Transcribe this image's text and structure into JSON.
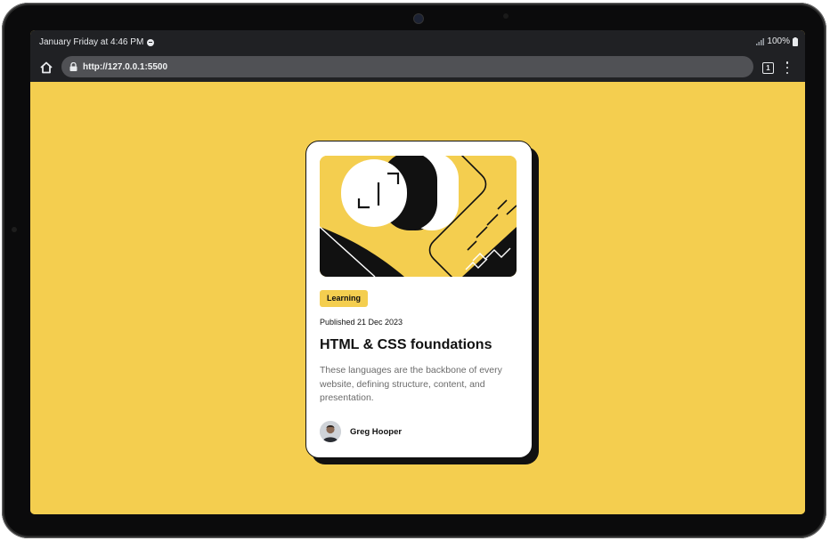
{
  "statusbar": {
    "datetime": "January Friday at 4:46 PM",
    "battery": "100%",
    "icons": [
      "notification-icon",
      "signal-icon",
      "battery-icon"
    ]
  },
  "browser": {
    "url": "http://127.0.0.1:5500",
    "tab_count": "1",
    "icons": [
      "home-icon",
      "lock-icon",
      "tabs-icon",
      "menu-icon"
    ]
  },
  "card": {
    "tag": "Learning",
    "published": "Published 21 Dec 2023",
    "title": "HTML & CSS foundations",
    "description": "These languages are the backbone of every website, defining structure, content, and presentation.",
    "author": "Greg Hooper"
  },
  "colors": {
    "page_bg": "#f4ce4f",
    "card_bg": "#ffffff",
    "card_shadow": "#111111",
    "browser_chrome": "#202124",
    "urlbar": "#505155"
  }
}
